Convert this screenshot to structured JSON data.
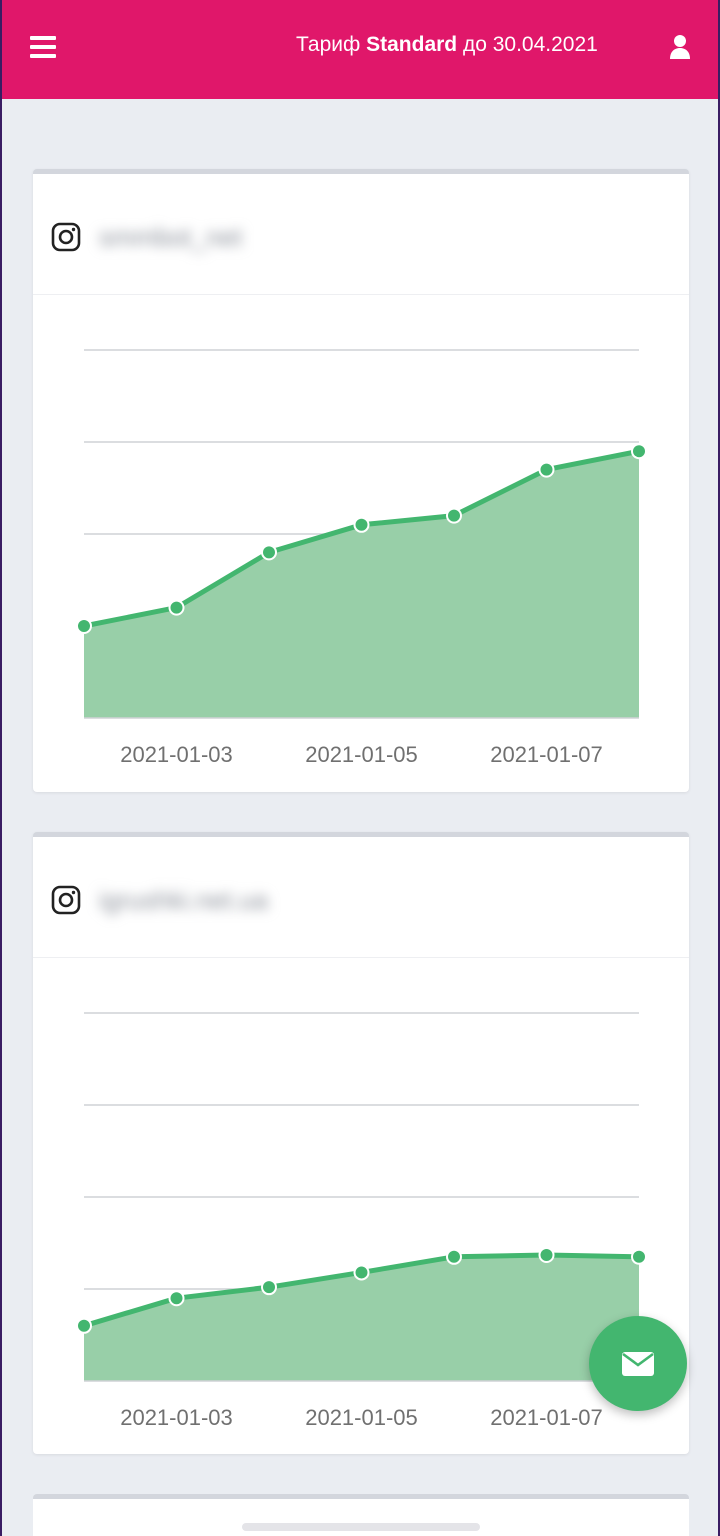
{
  "header": {
    "plan_prefix": "Тариф",
    "plan_name": "Standard",
    "plan_suffix": "до 30.04.2021",
    "menu_icon": "hamburger-menu-icon",
    "user_icon": "user-icon",
    "bar_color": "#e0176a"
  },
  "cards": [
    {
      "account": "smmbot_net",
      "icon": "instagram-icon"
    },
    {
      "account": "igrushki.net.ua",
      "icon": "instagram-icon"
    }
  ],
  "chart_data": [
    {
      "type": "area",
      "x": [
        "2021-01-02",
        "2021-01-03",
        "2021-01-04",
        "2021-01-05",
        "2021-01-06",
        "2021-01-07",
        "2021-01-08"
      ],
      "tick_labels": [
        "2021-01-03",
        "2021-01-05",
        "2021-01-07"
      ],
      "values": [
        1.0,
        1.2,
        1.8,
        2.1,
        2.2,
        2.7,
        2.9
      ],
      "ylim": [
        0,
        4
      ],
      "grid": true,
      "line_color": "#43b66f",
      "fill_color": "#98cfa8"
    },
    {
      "type": "area",
      "x": [
        "2021-01-02",
        "2021-01-03",
        "2021-01-04",
        "2021-01-05",
        "2021-01-06",
        "2021-01-07",
        "2021-01-08"
      ],
      "tick_labels": [
        "2021-01-03",
        "2021-01-05",
        "2021-01-07"
      ],
      "values": [
        0.6,
        0.9,
        1.02,
        1.18,
        1.35,
        1.37,
        1.35
      ],
      "ylim": [
        0,
        4
      ],
      "grid": true,
      "line_color": "#43b66f",
      "fill_color": "#98cfa8"
    }
  ],
  "fab": {
    "icon": "envelope-icon",
    "color": "#43b66f"
  }
}
